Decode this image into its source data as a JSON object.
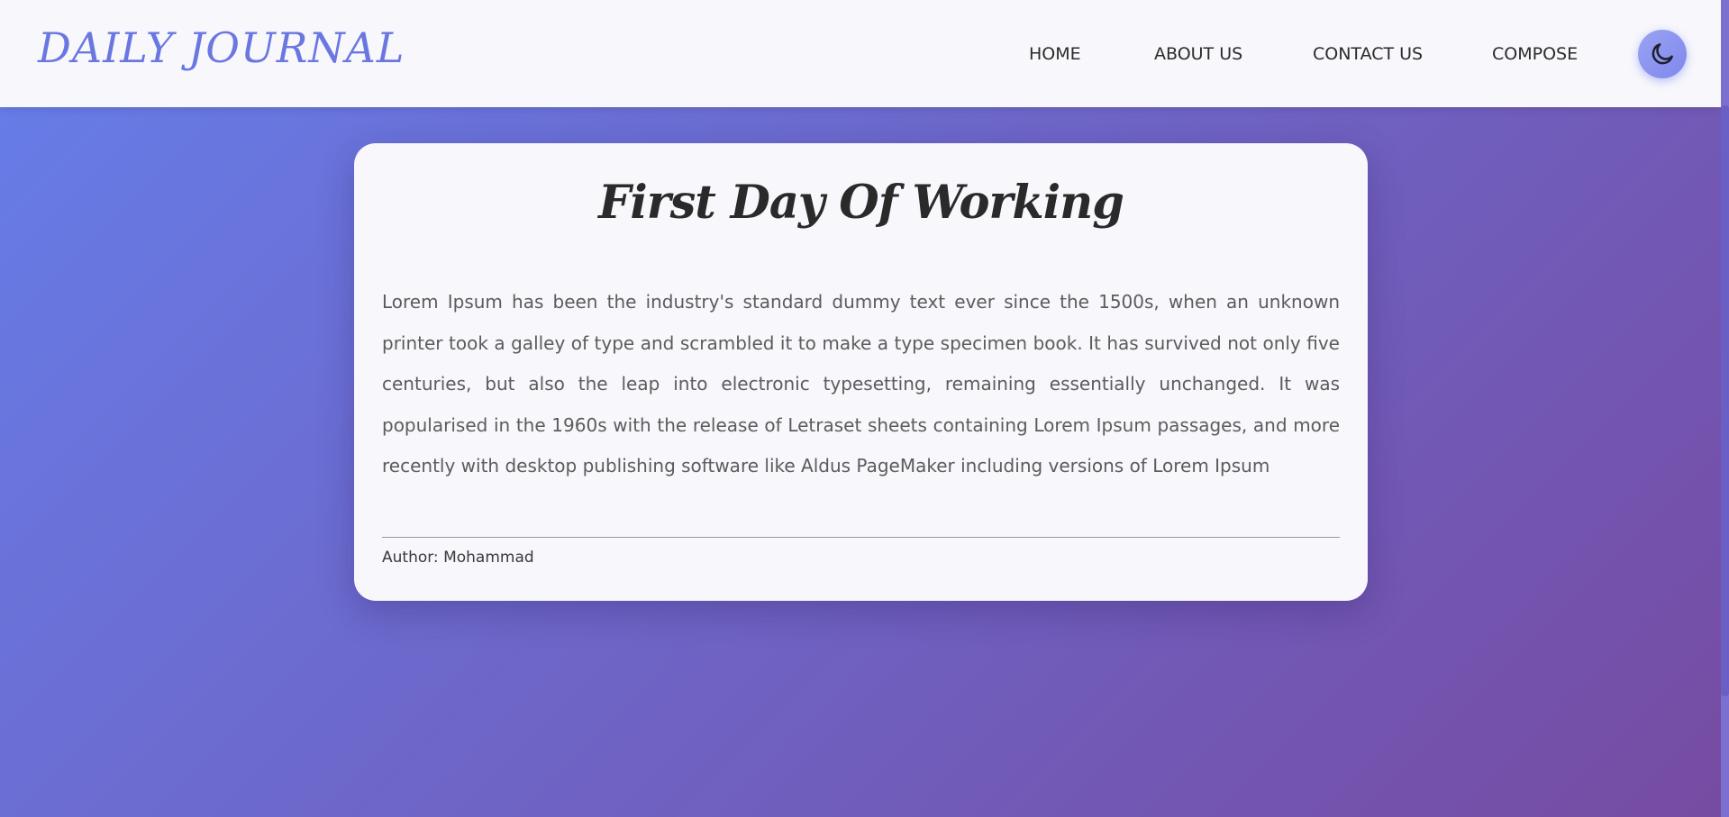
{
  "navbar": {
    "brand": "DAILY JOURNAL",
    "links": [
      {
        "label": "HOME"
      },
      {
        "label": "ABOUT US"
      },
      {
        "label": "CONTACT US"
      },
      {
        "label": "COMPOSE"
      }
    ],
    "theme_toggle_icon": "moon-icon"
  },
  "post": {
    "title": "First Day Of Working",
    "body": "Lorem Ipsum has been the industry's standard dummy text ever since the 1500s, when an unknown printer took a galley of type and scrambled it to make a type specimen book. It has survived not only five centuries, but also the leap into electronic typesetting, remaining essentially unchanged. It was popularised in the 1960s with the release of Letraset sheets containing Lorem Ipsum passages, and more recently with desktop publishing software like Aldus PageMaker including versions of Lorem Ipsum",
    "author": "Author: Mohammad"
  },
  "colors": {
    "gradient_start": "#667eea",
    "gradient_end": "#764ba2",
    "brand": "#6a77e0",
    "card_bg": "#f7f7fc",
    "text_dark": "#2a2a2a",
    "text_body": "#5c5c5c"
  }
}
